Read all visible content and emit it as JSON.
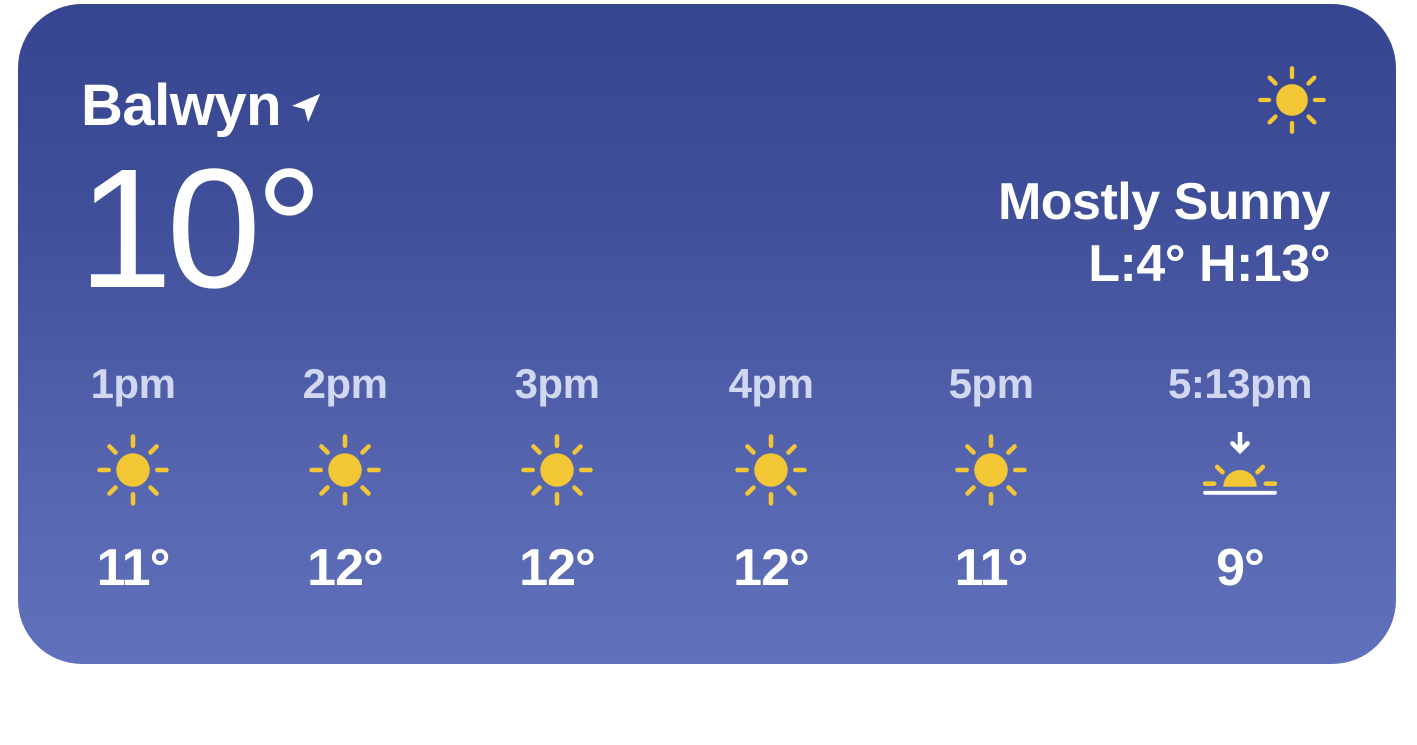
{
  "widget": {
    "location": "Balwyn",
    "location_icon": "location-arrow-icon",
    "current_temp": "10°",
    "condition_icon": "sun-icon",
    "condition": "Mostly Sunny",
    "hilo": "L:4° H:13°",
    "colors": {
      "background_top": "#36458f",
      "background_bottom": "#6071bb",
      "sun": "#f2c634",
      "hour_label": "#d2d7f0"
    },
    "hourly": [
      {
        "time": "1pm",
        "icon": "sun-icon",
        "temp": "11°"
      },
      {
        "time": "2pm",
        "icon": "sun-icon",
        "temp": "12°"
      },
      {
        "time": "3pm",
        "icon": "sun-icon",
        "temp": "12°"
      },
      {
        "time": "4pm",
        "icon": "sun-icon",
        "temp": "12°"
      },
      {
        "time": "5pm",
        "icon": "sun-icon",
        "temp": "11°"
      },
      {
        "time": "5:13pm",
        "icon": "sunset-icon",
        "temp": "9°"
      }
    ]
  }
}
